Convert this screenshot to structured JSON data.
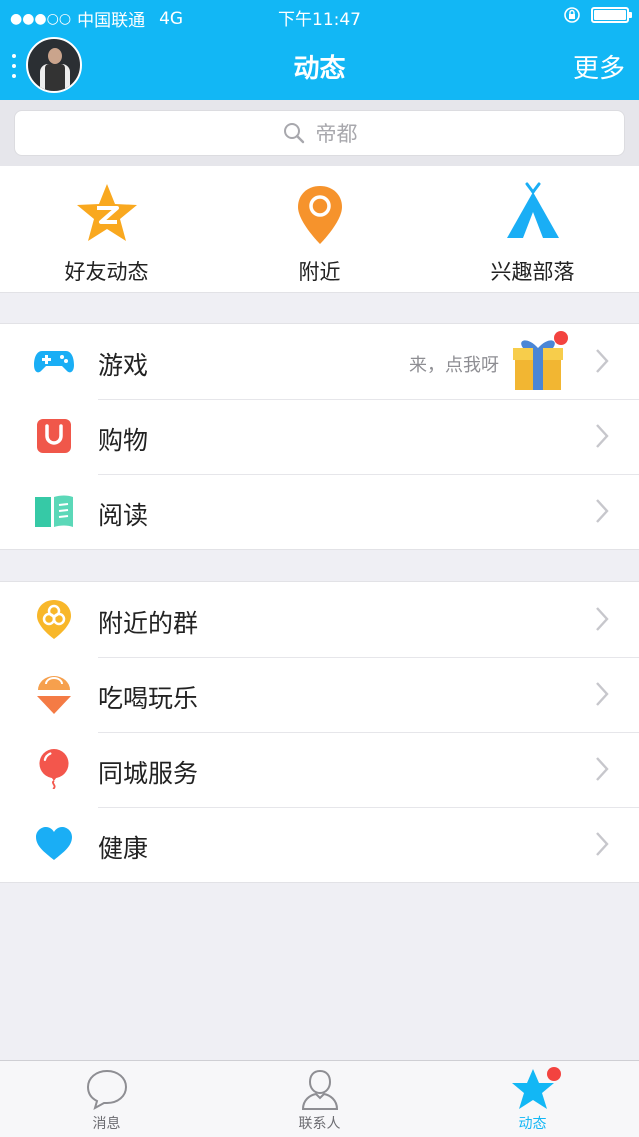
{
  "status": {
    "carrier": "中国联通",
    "network": "4G",
    "time": "下午11:47",
    "signal_dots": "●●●○○"
  },
  "nav": {
    "title": "动态",
    "more": "更多"
  },
  "search": {
    "placeholder": "帝都"
  },
  "quick": [
    {
      "label": "好友动态",
      "icon": "qzone-star-icon"
    },
    {
      "label": "附近",
      "icon": "location-pin-icon"
    },
    {
      "label": "兴趣部落",
      "icon": "tent-icon"
    }
  ],
  "group1": [
    {
      "label": "游戏",
      "icon": "gamepad-icon",
      "note": "来，点我呀"
    },
    {
      "label": "购物",
      "icon": "shopping-bag-icon"
    },
    {
      "label": "阅读",
      "icon": "book-icon"
    }
  ],
  "group2": [
    {
      "label": "附近的群",
      "icon": "nearby-group-icon"
    },
    {
      "label": "吃喝玩乐",
      "icon": "ice-cream-icon"
    },
    {
      "label": "同城服务",
      "icon": "balloon-icon"
    },
    {
      "label": "健康",
      "icon": "heart-icon"
    }
  ],
  "tabs": [
    {
      "label": "消息",
      "icon": "chat-bubble-icon"
    },
    {
      "label": "联系人",
      "icon": "contacts-icon"
    },
    {
      "label": "动态",
      "icon": "star-icon",
      "active": true
    }
  ],
  "colors": {
    "brand": "#12b7f5",
    "badge": "#f3433f"
  }
}
